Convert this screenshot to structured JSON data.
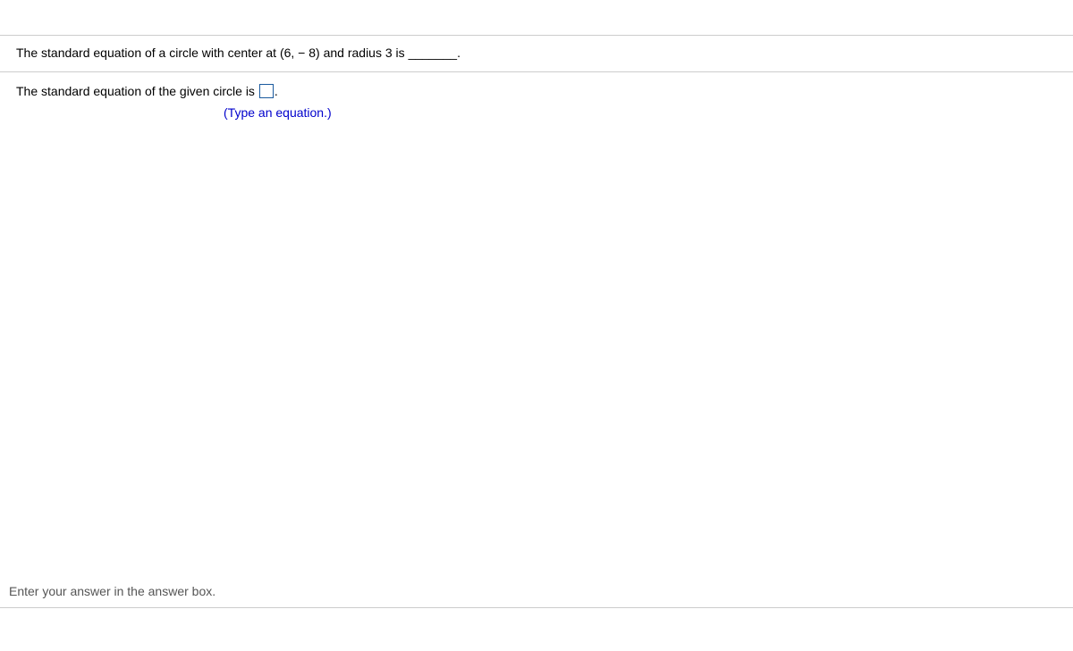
{
  "question": {
    "prefix": "The standard equation of a circle with center at ",
    "center": "(6, − 8)",
    "mid": " and radius ",
    "radius": "3",
    "after_radius": " is ",
    "blank": "_______",
    "suffix": "."
  },
  "answer": {
    "prefix": "The standard equation of the given circle is ",
    "suffix": ".",
    "hint": "(Type an equation.)",
    "value": ""
  },
  "footer": {
    "instruction": "Enter your answer in the answer box."
  }
}
